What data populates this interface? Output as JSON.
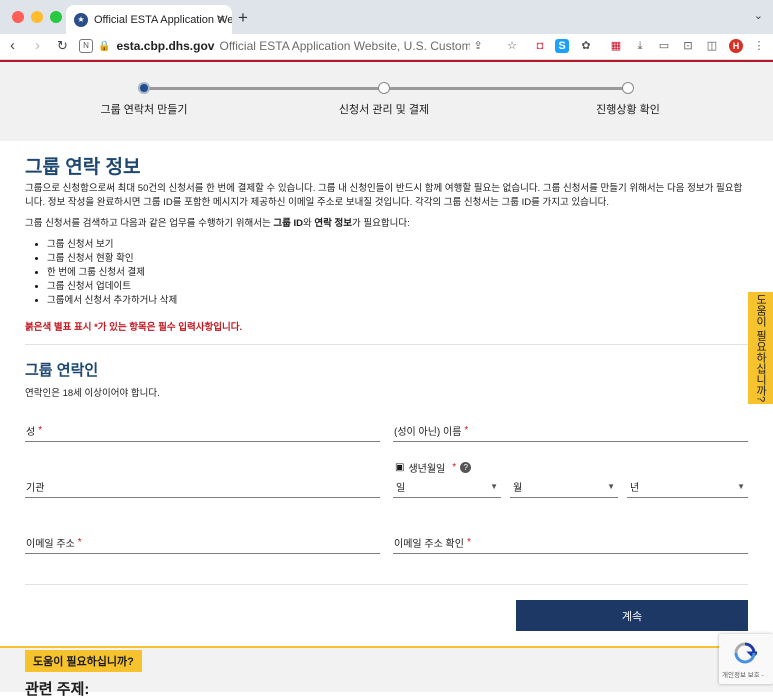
{
  "browser": {
    "tab_title": "Official ESTA Application Webs",
    "tab_close": "✕",
    "new_tab": "+",
    "url_host": "esta.cbp.dhs.gov",
    "url_rest": "Official ESTA Application Website, U.S. Custom",
    "profile_initial": "H"
  },
  "progress": {
    "steps": [
      {
        "label": "그룹 연락처 만들기",
        "active": true
      },
      {
        "label": "신청서 관리 및 결제",
        "active": false
      },
      {
        "label": "진행상황 확인",
        "active": false
      }
    ]
  },
  "page": {
    "title": "그룹 연락 정보",
    "intro": "그룹으로 신청함으로써 최대 50건의 신청서를 한 번에 결제할 수 있습니다. 그룹 내 신청인들이 반드시 함께 여행할 필요는 없습니다. 그룹 신청서를 만들기 위해서는 다음 정보가 필요합니다. 정보 작성을 완료하시면 그룹 ID를 포함한 메시지가 제공하신 이메일 주소로 보내질 것입니다. 각각의 그룹 신청서는 그룹 ID를 가지고 있습니다.",
    "needs_prefix": "그룹 신청서를 검색하고 다음과 같은 업무를 수행하기 위해서는 ",
    "needs_group_id": "그룹 ID",
    "needs_and": "와 ",
    "needs_contact": "연락 정보",
    "needs_suffix": "가 필요합니다:",
    "bullets": [
      "그룹 신청서 보기",
      "그룹 신청서 현황 확인",
      "한 번에 그룹 신청서 결제",
      "그룹 신청서 업데이트",
      "그룹에서 신청서 추가하거나 삭제"
    ],
    "required_note": "붉은색 별표 표시 *가 있는 항목은 필수 입력사항입니다."
  },
  "contact": {
    "title": "그룹 연락인",
    "age_note": "연락인은 18세 이상이어야 합니다.",
    "last_name": "성",
    "first_name": "(성이 아닌) 이름",
    "organization": "기관",
    "dob_label": "생년월일",
    "day": "일",
    "month": "월",
    "year": "년",
    "email": "이메일 주소",
    "email_confirm": "이메일 주소 확인",
    "required_mark": "*",
    "continue_button": "계속"
  },
  "help": {
    "side_tab": "도움이 필요하십니까?",
    "banner": "도움이 필요하십니까?",
    "related": "관련 주제:"
  },
  "recaptcha": {
    "text": "개인정보 보호 -"
  },
  "colors": {
    "accent": "#1d4670",
    "button": "#1e3866",
    "required": "#c21a22",
    "help": "#f6c22e"
  }
}
